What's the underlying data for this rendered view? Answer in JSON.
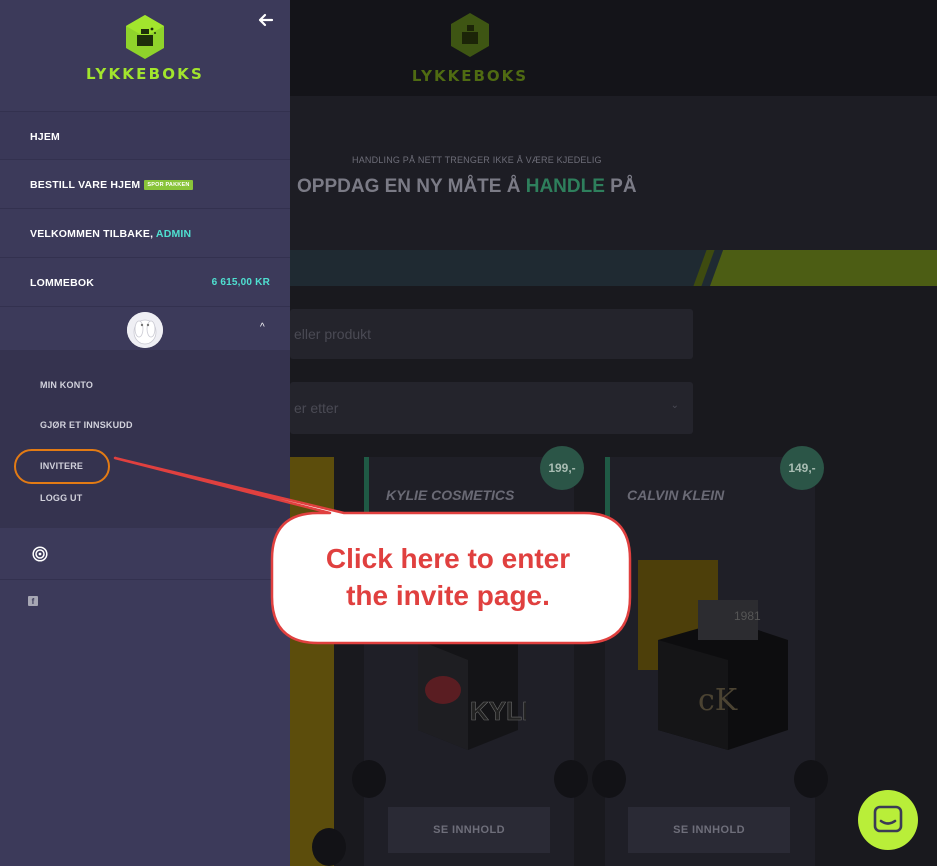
{
  "brand": {
    "name": "LYKKEBOKS",
    "accent": "#a2e52d"
  },
  "sidebar": {
    "back_icon": "arrow-left-icon",
    "nav": {
      "home": "HJEM",
      "order_home": "BESTILL VARE HJEM",
      "track_badge": "SPOR PAKKEN",
      "welcome": "VELKOMMEN TILBAKE,",
      "username": "ADMIN",
      "wallet_label": "LOMMEBOK",
      "wallet_amount": "6 615,00 KR"
    },
    "submenu": {
      "my_account": "MIN KONTO",
      "deposit": "GJØR ET INNSKUDD",
      "invite": "INVITERE",
      "logout": "LOGG UT"
    },
    "icons": [
      "target-icon",
      "facebook-icon"
    ]
  },
  "background": {
    "hero_subtitle": "HANDLING PÅ NETT TRENGER IKKE Å VÆRE KJEDELIG",
    "hero_title_before": "OPPDAG EN NY MÅTE Å ",
    "hero_title_highlight": "HANDLE",
    "hero_title_after": " PÅ",
    "search_placeholder": "eller produkt",
    "sort_placeholder": "er etter",
    "cards": [
      {
        "name": "KYLIE COSMETICS",
        "price": "199,-",
        "button": "SE INNHOLD"
      },
      {
        "name": "CALVIN KLEIN",
        "price": "149,-",
        "button": "SE INNHOLD"
      }
    ]
  },
  "callout": {
    "line1": "Click here to enter",
    "line2": "the invite page.",
    "color": "#e0403f"
  },
  "chat": {
    "icon": "chat-smile-icon"
  }
}
